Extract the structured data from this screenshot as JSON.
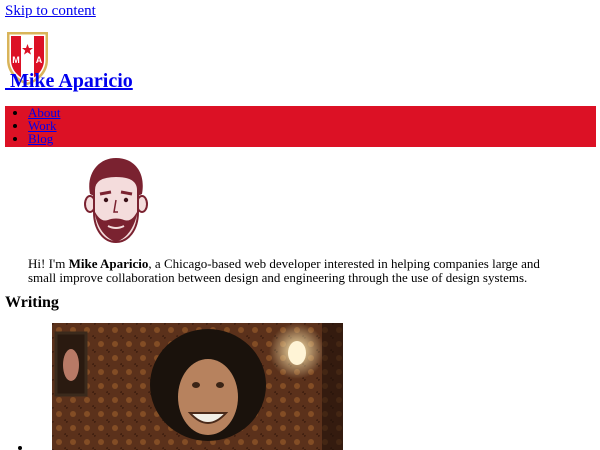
{
  "skip_link": "Skip to content",
  "site": {
    "title": "Mike Aparicio",
    "logo_letters": [
      "M",
      "A"
    ]
  },
  "nav": {
    "items": [
      "About",
      "Work",
      "Blog"
    ]
  },
  "intro": {
    "prefix": "Hi! I'm ",
    "name": "Mike Aparicio",
    "suffix": ", a Chicago-based web developer interested in helping companies large and small improve collaboration between design and engineering through the use of design systems."
  },
  "writing": {
    "heading": "Writing"
  },
  "colors": {
    "nav_background": "#dc1125",
    "link": "#0000ee",
    "crest_red": "#dc1125",
    "crest_gold": "#d9b45a"
  }
}
